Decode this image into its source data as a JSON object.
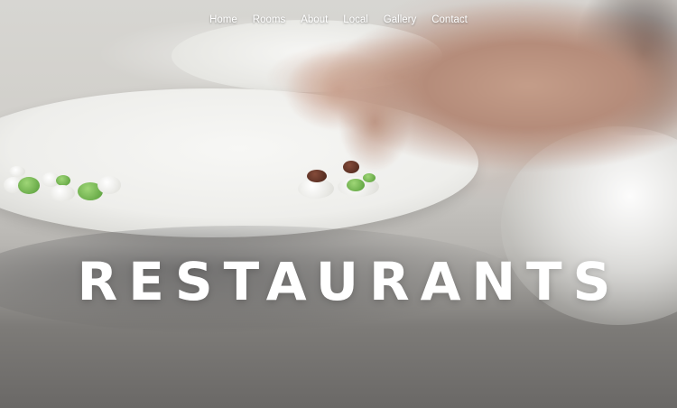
{
  "nav": {
    "items": [
      {
        "label": "Home"
      },
      {
        "label": "Rooms"
      },
      {
        "label": "About"
      },
      {
        "label": "Local"
      },
      {
        "label": "Gallery"
      },
      {
        "label": "Contact"
      }
    ]
  },
  "hero": {
    "title": "RESTAURANTS",
    "image": "chef-plating-dish-photo"
  },
  "colors": {
    "nav_text": "#ffffff",
    "title_text": "#ffffff"
  }
}
